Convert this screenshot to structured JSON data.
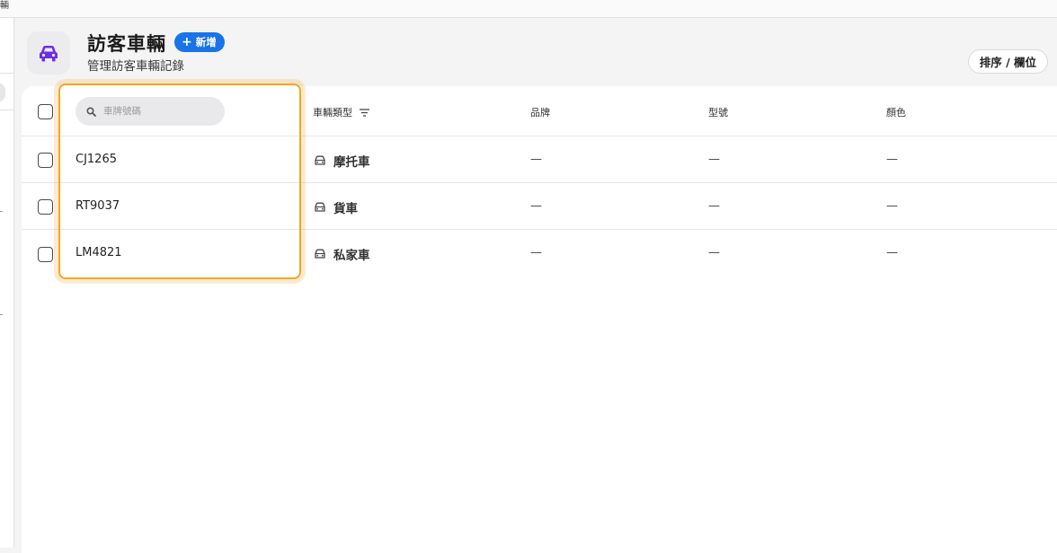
{
  "topbar": {
    "fragment": "輛"
  },
  "header": {
    "title": "訪客車輛",
    "add_label": "新增",
    "subtitle": "管理訪客車輛記錄",
    "sort_label": "排序 / 欄位"
  },
  "accent_color": "#1a73e8",
  "icon_color": "#6a2ee8",
  "highlight_color": "#f5a623",
  "table": {
    "search_placeholder": "車牌號碼",
    "columns": {
      "type": "車輛類型",
      "brand": "品牌",
      "model": "型號",
      "color": "顏色"
    },
    "rows": [
      {
        "plate": "CJ1265",
        "type": "摩托車",
        "brand": "—",
        "model": "—",
        "color": "—"
      },
      {
        "plate": "RT9037",
        "type": "貨車",
        "brand": "—",
        "model": "—",
        "color": "—"
      },
      {
        "plate": "LM4821",
        "type": "私家車",
        "brand": "—",
        "model": "—",
        "color": "—"
      }
    ]
  },
  "icons": {
    "app": "car-icon",
    "search": "search-icon",
    "filter": "filter-icon",
    "vehicle": "car-outline-icon"
  }
}
